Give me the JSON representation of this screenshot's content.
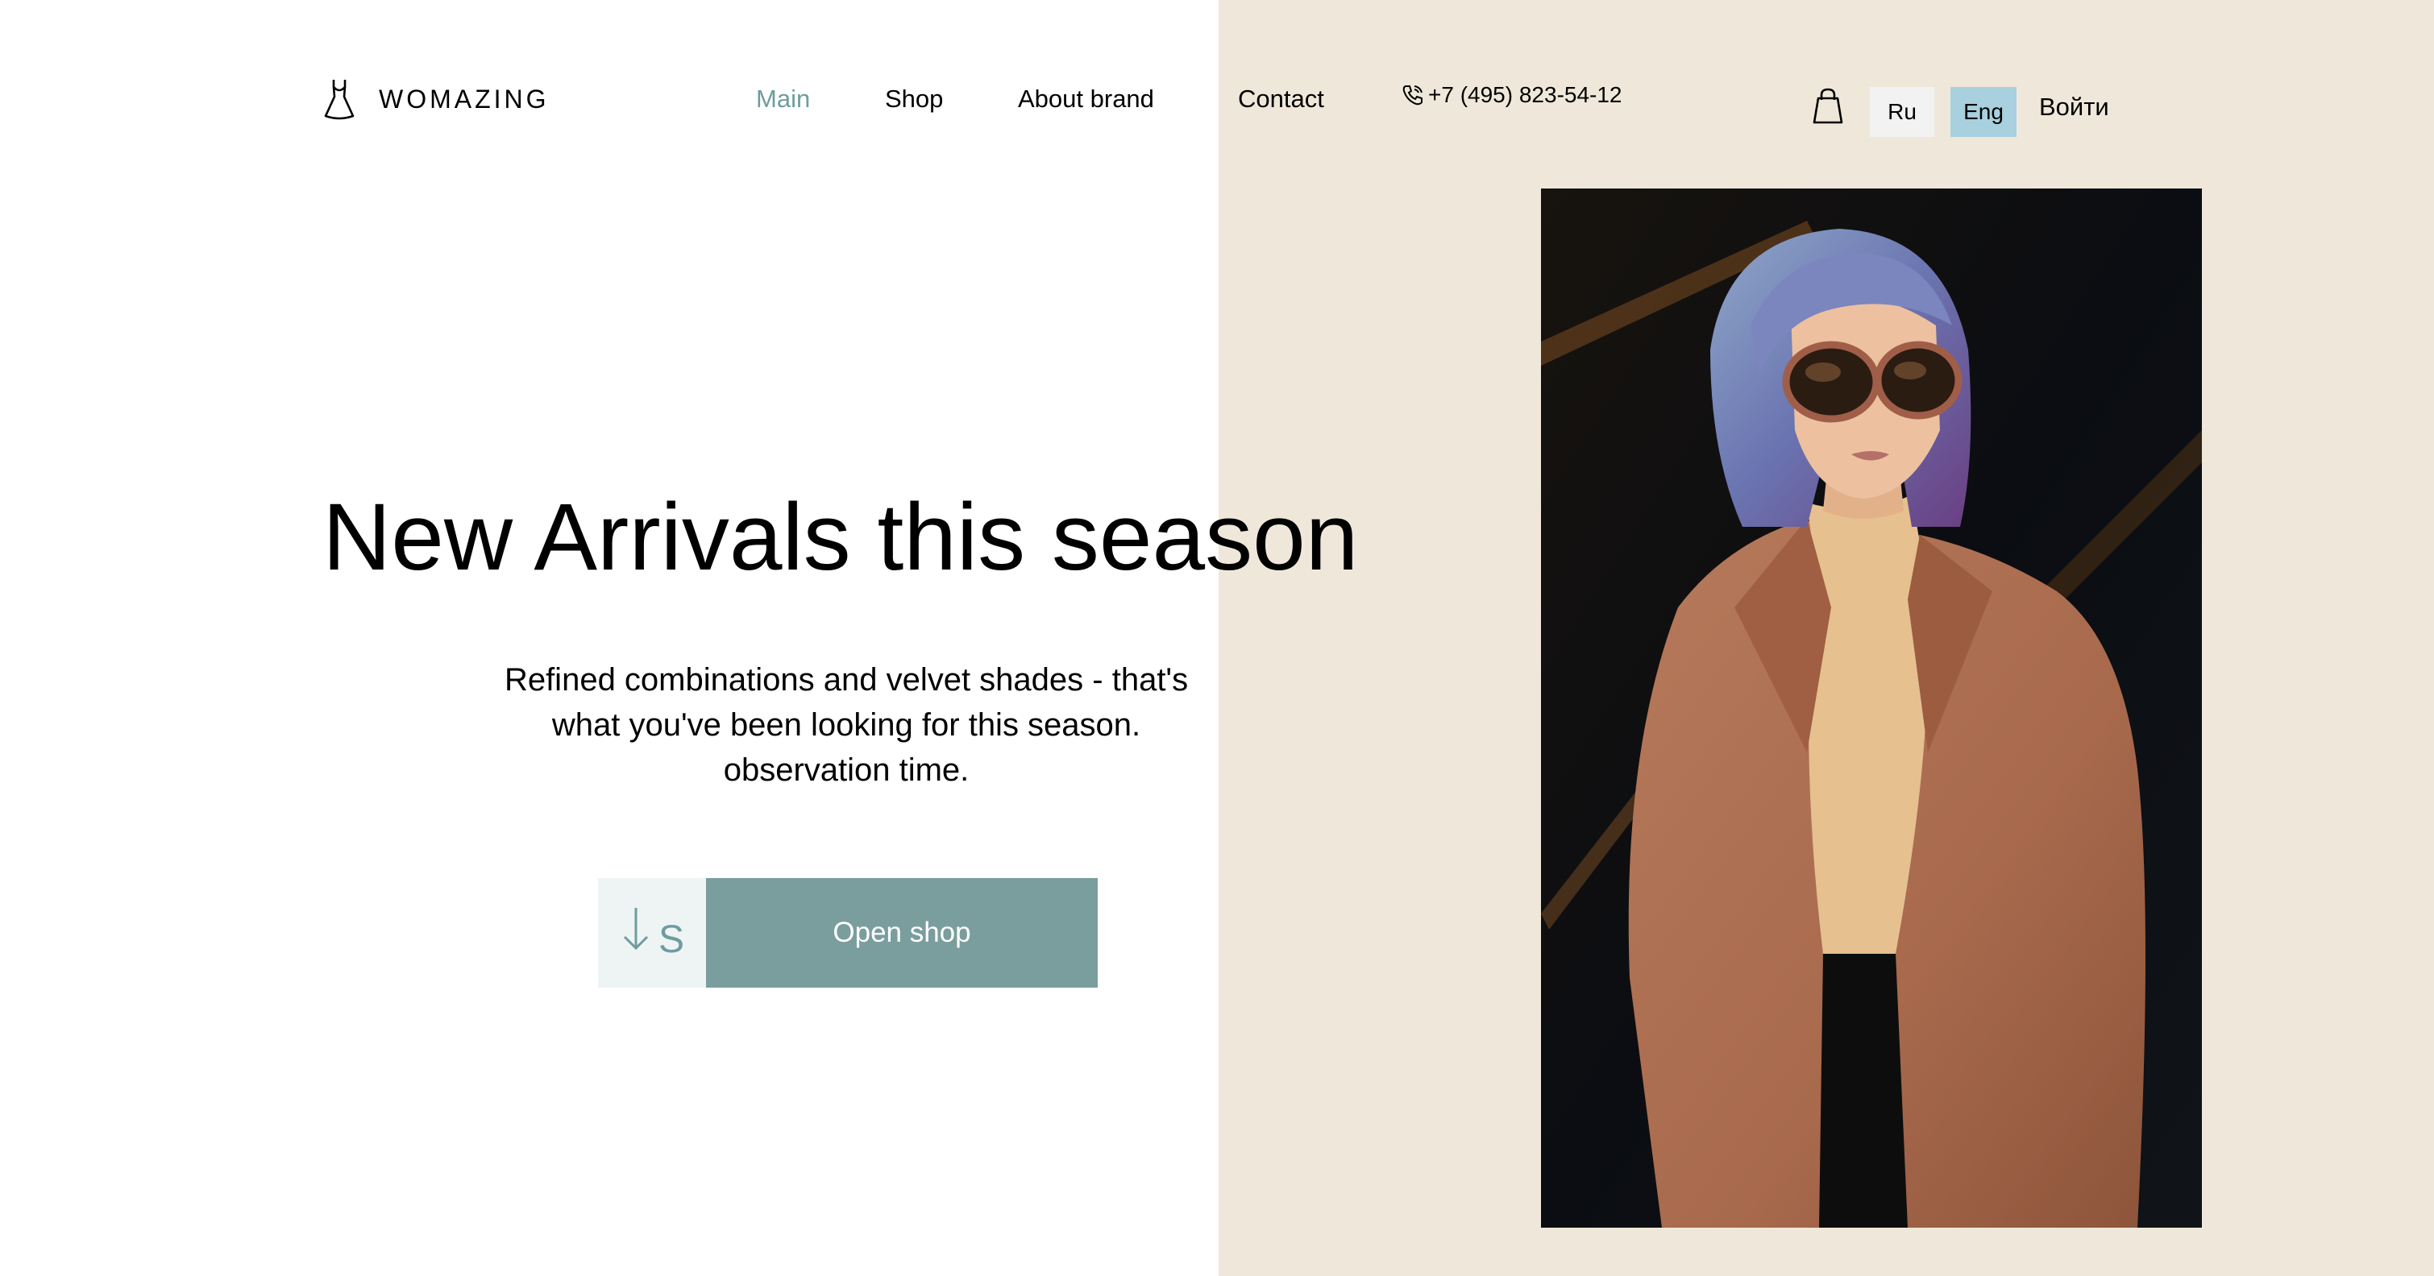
{
  "header": {
    "logo_text": "WOMAZING",
    "nav": [
      {
        "label": "Main",
        "active": true
      },
      {
        "label": "Shop",
        "active": false
      },
      {
        "label": "About brand",
        "active": false
      },
      {
        "label": "Contact",
        "active": false
      }
    ],
    "phone": "+7 (495) 823-54-12",
    "languages": [
      {
        "label": "Ru",
        "selected": false
      },
      {
        "label": "Eng",
        "selected": true
      }
    ],
    "login_label": "Войти"
  },
  "hero": {
    "title": "New Arrivals this season",
    "subtitle": "Refined combinations and velvet shades - that's what you've been looking for this season. observation time.",
    "scroll_letter": "S",
    "cta_label": "Open shop"
  },
  "colors": {
    "accent": "#6e9c9f",
    "button": "#7a9e9d",
    "panel": "#efe8da",
    "lang_selected": "#a8d0df"
  },
  "icons": {
    "logo": "dress-icon",
    "phone": "phone-icon",
    "cart": "shopping-bag-icon",
    "scroll": "arrow-down-icon"
  }
}
